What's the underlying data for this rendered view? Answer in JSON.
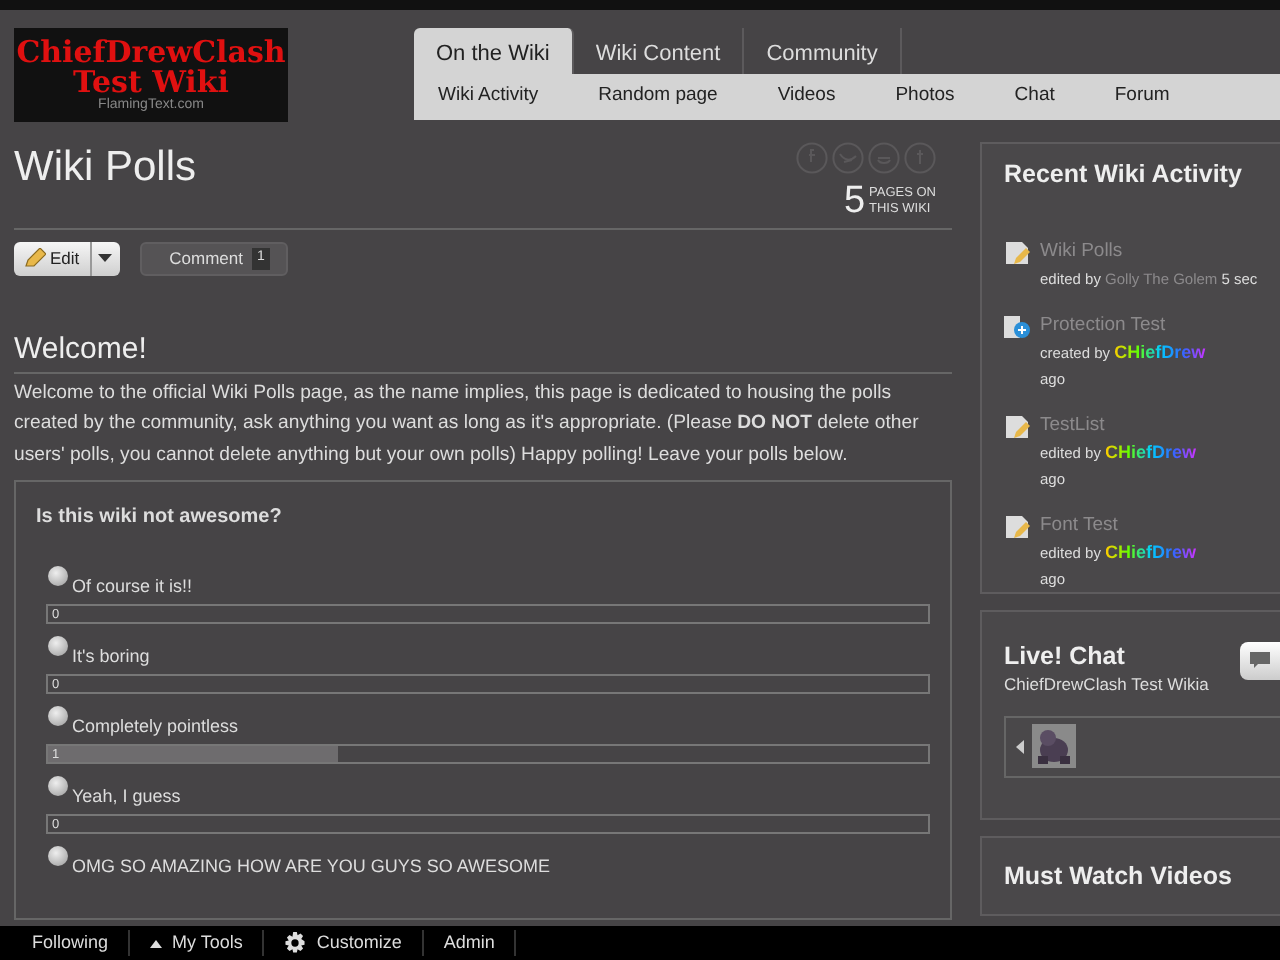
{
  "logo": {
    "line1": "ChiefDrewClash",
    "line2": "Test Wiki",
    "tagline": "FlamingText.com"
  },
  "nav": {
    "tabs": [
      {
        "label": "On the Wiki",
        "selected": true
      },
      {
        "label": "Wiki Content",
        "selected": false
      },
      {
        "label": "Community",
        "selected": false
      }
    ],
    "subnav": [
      "Wiki Activity",
      "Random page",
      "Videos",
      "Photos",
      "Chat",
      "Forum"
    ]
  },
  "page": {
    "title": "Wiki Polls",
    "pages_count": "5",
    "pages_label": [
      "PAGES ON",
      "THIS WIKI"
    ],
    "edit_button": "Edit",
    "comment_button": "Comment",
    "comment_count": "1"
  },
  "section": {
    "heading": "Welcome!",
    "text": "Welcome to the official Wiki Polls page, as the name implies, this page is dedicated to housing the polls created by the community, ask anything you want as long as it's appropriate. (Please **DO NOT** delete other users' polls, you cannot delete anything but your own polls) Happy polling! Leave your polls below."
  },
  "poll": {
    "question": "Is this wiki not awesome?",
    "options": [
      {
        "label": "Of course it is!!",
        "count": "0",
        "level": 0,
        "selected": false
      },
      {
        "label": "It's boring",
        "count": "0",
        "level": 0,
        "selected": false
      },
      {
        "label": "Completely pointless",
        "count": "1",
        "level": 0.33,
        "selected": false
      },
      {
        "label": "Yeah, I guess",
        "count": "0",
        "level": 0,
        "selected": false
      },
      {
        "label": "OMG SO AMAZING HOW ARE YOU GUYS SO AWESOME",
        "selected": false
      }
    ]
  },
  "activity": {
    "title": "Recent Wiki Activity",
    "items": [
      {
        "kind": "edit",
        "title": "Wiki Polls",
        "action": "edited by",
        "user": "Golly The Golem",
        "rainbow": false,
        "time": "5 sec"
      },
      {
        "kind": "create",
        "title": "Protection Test",
        "action": "created by",
        "user": "CHiefDrew",
        "rainbow": true,
        "time": "ago"
      },
      {
        "kind": "edit",
        "title": "TestList",
        "action": "edited by",
        "user": "CHiefDrew",
        "rainbow": true,
        "time": "ago"
      },
      {
        "kind": "edit",
        "title": "Font Test",
        "action": "edited by",
        "user": "CHiefDrew",
        "rainbow": true,
        "time": "ago"
      }
    ]
  },
  "chat": {
    "title": "Live! Chat",
    "wiki": "ChiefDrewClash Test Wikia"
  },
  "videos": {
    "title": "Must Watch Videos"
  },
  "toolbar": [
    {
      "kind": "plain",
      "label": "Following"
    },
    {
      "kind": "caret",
      "label": "My Tools"
    },
    {
      "kind": "gear",
      "label": "Customize"
    },
    {
      "kind": "plain",
      "label": "Admin"
    }
  ]
}
